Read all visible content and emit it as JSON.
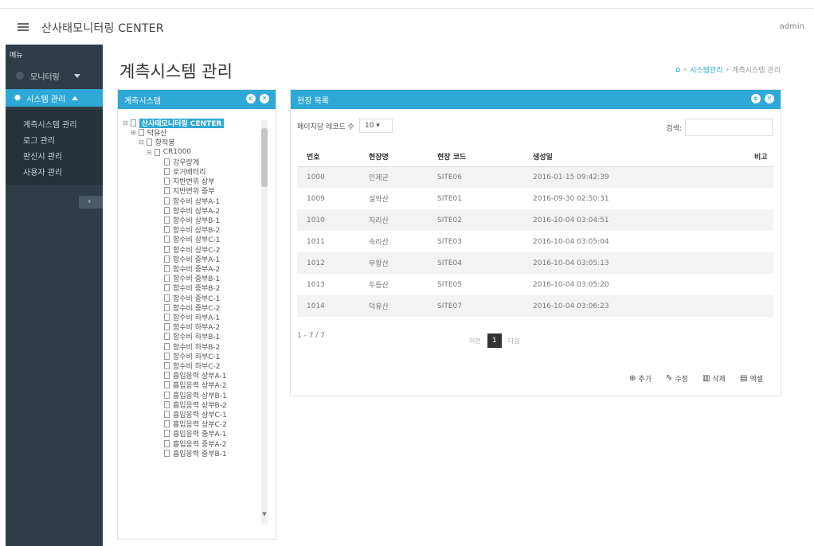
{
  "app": {
    "title": "산사태모니터링 CENTER",
    "user": "admin"
  },
  "sidebar": {
    "menu_title": "메뉴",
    "monitoring_label": "모니터링",
    "system_label": "시스템 관리",
    "sub_items": [
      "계측시스템 관리",
      "로그 관리",
      "판신시 관리",
      "사용자 관리"
    ]
  },
  "page": {
    "title": "계측시스템 관리",
    "breadcrumb": [
      "홈",
      "시스템관리",
      "계측시스템 관리"
    ]
  },
  "left_panel": {
    "title": "계측시스템",
    "tree": {
      "root": "산사태모니터링 CENTER",
      "level1": "덕유산",
      "level2": "향적봉",
      "level3": "CR1000",
      "leaves": [
        "강우량계",
        "로거배터리",
        "지반변위 상부",
        "지반변위 중부",
        "함수비 상부A-1",
        "함수비 상부A-2",
        "함수비 상부B-1",
        "함수비 상부B-2",
        "함수비 상부C-1",
        "함수비 상부C-2",
        "함수비 중부A-1",
        "함수비 중부A-2",
        "함수비 중부B-1",
        "함수비 중부B-2",
        "함수비 중부C-1",
        "함수비 중부C-2",
        "함수비 하부A-1",
        "함수비 하부A-2",
        "함수비 하부B-1",
        "함수비 하부B-2",
        "함수비 하부C-1",
        "함수비 하부C-2",
        "흡입응력 상부A-1",
        "흡입응력 상부A-2",
        "흡입응력 상부B-1",
        "흡입응력 상부B-2",
        "흡입응력 상부C-1",
        "흡입응력 상부C-2",
        "흡입응력 중부A-1",
        "흡입응력 중부A-2",
        "흡입응력 중부B-1"
      ]
    }
  },
  "right_panel": {
    "title": "현장 목록",
    "page_size_label": "페이지당 레코드 수",
    "page_size_value": "10",
    "search_label": "검색:",
    "columns": [
      "번호",
      "현장명",
      "현장 코드",
      "생성일",
      "비고"
    ],
    "rows": [
      [
        "1000",
        "인제군",
        "SITE06",
        "2016-01-15 09:42:39",
        ""
      ],
      [
        "1009",
        "설악산",
        "SITE01",
        "2016-09-30 02:50:31",
        ""
      ],
      [
        "1010",
        "지리산",
        "SITE02",
        "2016-10-04 03:04:51",
        ""
      ],
      [
        "1011",
        "속리산",
        "SITE03",
        "2016-10-04 03:05:04",
        ""
      ],
      [
        "1012",
        "무왕산",
        "SITE04",
        "2016-10-04 03:05:13",
        ""
      ],
      [
        "1013",
        "두등산",
        "SITE05",
        "2016-10-04 03:05:20",
        ""
      ],
      [
        "1014",
        "덕유산",
        "SITE07",
        "2016-10-04 03:06:23",
        ""
      ]
    ],
    "page_info": "1 - 7 / 7",
    "pager": {
      "prev": "이전",
      "current": "1",
      "next": "다음"
    },
    "actions": {
      "add": "추가",
      "edit": "수정",
      "delete": "삭제",
      "excel": "엑셀"
    }
  },
  "colors": {
    "accent": "#2ea8d6",
    "sidebar": "#2f3e46"
  }
}
